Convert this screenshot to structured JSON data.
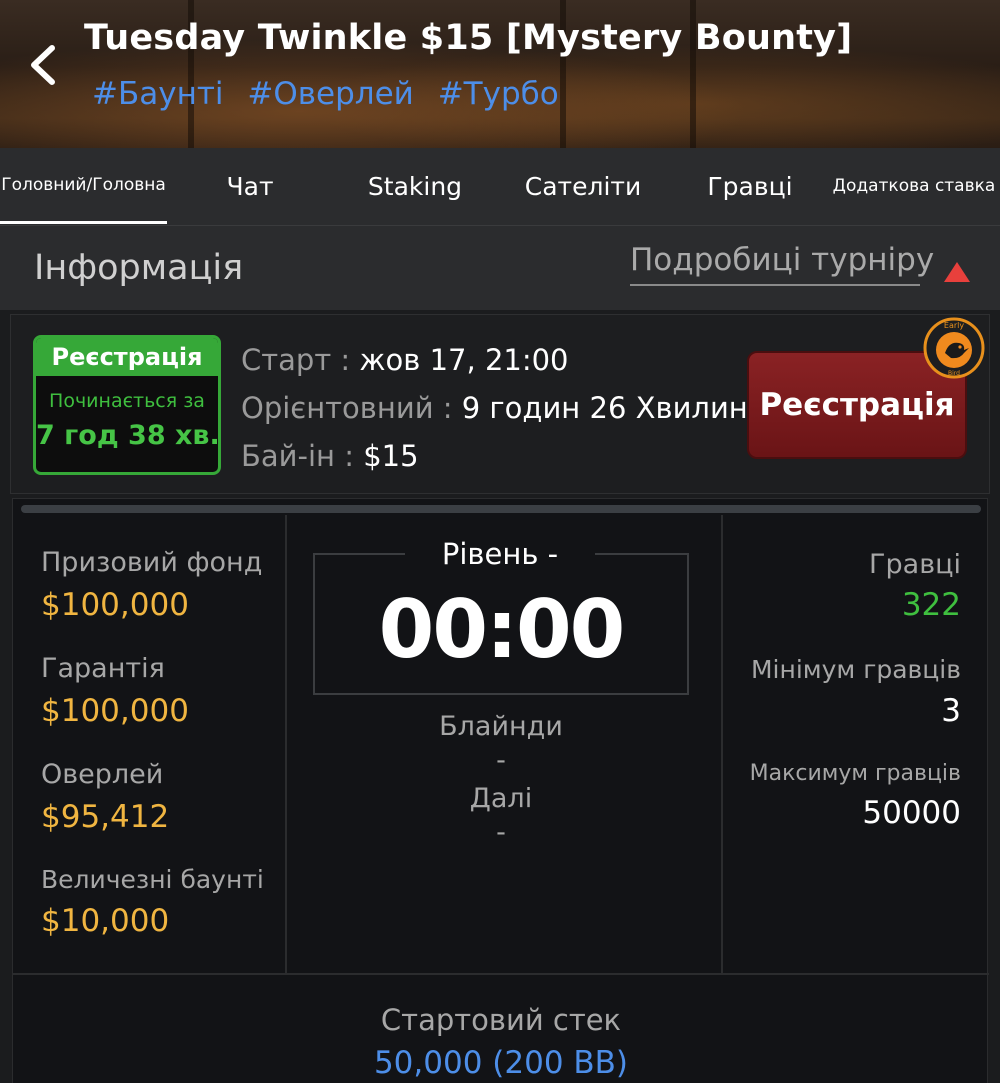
{
  "header": {
    "title": "Tuesday Twinkle $15 [Mystery Bounty]",
    "tags": [
      "#Баунті",
      "#Оверлей",
      "#Турбо"
    ]
  },
  "tabs": [
    {
      "label": "Головний/Головна",
      "active": true
    },
    {
      "label": "Чат",
      "active": false
    },
    {
      "label": "Staking",
      "active": false
    },
    {
      "label": "Сателіти",
      "active": false
    },
    {
      "label": "Гравці",
      "active": false
    },
    {
      "label": "Додаткова ставка",
      "active": false
    }
  ],
  "info": {
    "title": "Інформація",
    "details_link": "Подробиці турніру"
  },
  "registration": {
    "status": "Реєстрація",
    "starts_in_label": "Починається за",
    "starts_in_value": "7 год 38 хв.",
    "start_label": "Старт :",
    "start_value": "жов 17, 21:00",
    "estimated_label": "Орієнтовний :",
    "estimated_value": "9 годин 26 Хвилин",
    "buyin_label": "Бай-ін :",
    "buyin_value": "$15",
    "button_label": "Реєстрація",
    "early_badge_top": "Early",
    "early_badge_bottom": "Bird"
  },
  "stats": {
    "prize_pool_label": "Призовий фонд",
    "prize_pool_value": "$100,000",
    "guarantee_label": "Гарантія",
    "guarantee_value": "$100,000",
    "overlay_label": "Оверлей",
    "overlay_value": "$95,412",
    "huge_bounty_label": "Величезні баунті",
    "huge_bounty_value": "$10,000",
    "level_label": "Рівень -",
    "clock": "00:00",
    "blinds_label": "Блайнди",
    "blinds_value": "-",
    "next_label": "Далі",
    "next_value": "-",
    "players_label": "Гравці",
    "players_value": "322",
    "min_players_label": "Мінімум гравців",
    "min_players_value": "3",
    "max_players_label": "Максимум гравців",
    "max_players_value": "50000",
    "starting_stack_label": "Стартовий стек",
    "starting_stack_value": "50,000 (200 BB)"
  },
  "colors": {
    "accent_blue": "#4d8ee8",
    "gold": "#f0b541",
    "green": "#3fbf3f",
    "register_red": "#7a1a1c"
  }
}
